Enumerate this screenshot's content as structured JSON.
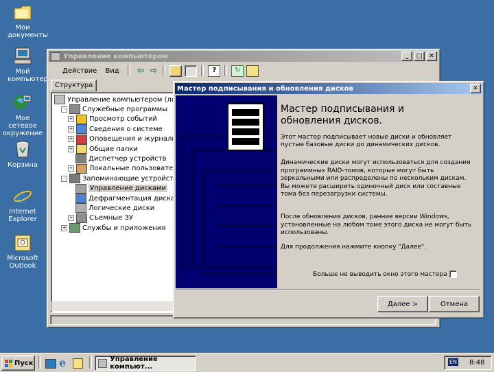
{
  "desktop": {
    "icons": [
      {
        "label": "Мои документы",
        "icon": "my-documents-icon"
      },
      {
        "label": "Мой компьютер",
        "icon": "my-computer-icon"
      },
      {
        "label": "Мое сетевое окружение",
        "icon": "network-icon"
      },
      {
        "label": "Корзина",
        "icon": "recycle-bin-icon"
      },
      {
        "label": "Internet Explorer",
        "icon": "ie-icon"
      },
      {
        "label": "Microsoft Outlook",
        "icon": "outlook-icon"
      }
    ]
  },
  "mmc": {
    "title": "Управление компьютером",
    "menu": {
      "action": "Действие",
      "view": "Вид"
    },
    "tab": "Структура",
    "tree": [
      {
        "label": "Управление компьютером (локальн",
        "level": 0,
        "expander": ""
      },
      {
        "label": "Служебные программы",
        "level": 1,
        "expander": "-"
      },
      {
        "label": "Просмотр событий",
        "level": 2,
        "expander": "+"
      },
      {
        "label": "Сведения о системе",
        "level": 2,
        "expander": "+"
      },
      {
        "label": "Оповещения и журналы пр",
        "level": 2,
        "expander": "+"
      },
      {
        "label": "Общие папки",
        "level": 2,
        "expander": "+"
      },
      {
        "label": "Диспетчер устройств",
        "level": 2,
        "expander": ""
      },
      {
        "label": "Локальные пользователи и",
        "level": 2,
        "expander": "+"
      },
      {
        "label": "Запоминающие устройства",
        "level": 1,
        "expander": "-"
      },
      {
        "label": "Управление дисками",
        "level": 2,
        "expander": "",
        "selected": true
      },
      {
        "label": "Дефрагментация диска",
        "level": 2,
        "expander": ""
      },
      {
        "label": "Логические диски",
        "level": 2,
        "expander": ""
      },
      {
        "label": "Съемные ЗУ",
        "level": 2,
        "expander": "+"
      },
      {
        "label": "Службы и приложения",
        "level": 1,
        "expander": "+"
      }
    ]
  },
  "wizard": {
    "title": "Мастер подписывания и обновления дисков",
    "heading": "Мастер подписывания и обновления дисков.",
    "p1": "Этот мастер подписывает новые диски и обновляет пустые базовые диски до динамических дисков.",
    "p2": "Динамические диски могут использоваться для создания программных RAID-томов, которые могут быть зеркальными или распределены по нескольким дискам. Вы можете расширить одиночный диск или составные тома без перезагрузки системы.",
    "p3": "После обновления дисков, ранние версии Windows, установленные на любом томе этого диска не могут быть использованы.",
    "p4": "Для продолжения нажмите кнопку \"Далее\".",
    "checkbox_label": "Больше не выводить окно этого мастера",
    "next": "Далее >",
    "cancel": "Отмена"
  },
  "taskbar": {
    "start": "Пуск",
    "task": "Управление компьют...",
    "lang": "EN",
    "time": "8:48"
  }
}
